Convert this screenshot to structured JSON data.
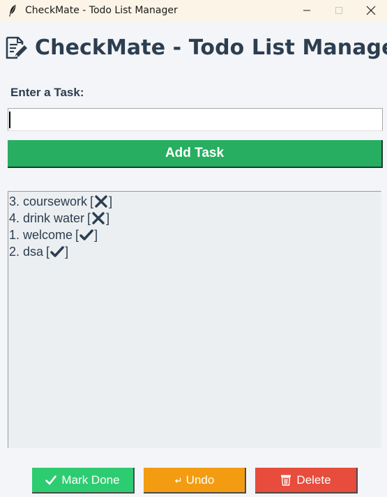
{
  "window": {
    "title": "CheckMate - Todo List Manager",
    "icon": "feather-icon"
  },
  "header": {
    "icon": "memo-pencil-icon",
    "title": "CheckMate - Todo List Manager"
  },
  "form": {
    "label": "Enter a Task:",
    "input_value": "",
    "add_button_label": "Add Task"
  },
  "tasks": [
    {
      "text": "3. coursework",
      "status": "pending",
      "status_icon": "cross-mark-icon"
    },
    {
      "text": "4. drink water",
      "status": "pending",
      "status_icon": "cross-mark-icon"
    },
    {
      "text": "1. welcome",
      "status": "done",
      "status_icon": "check-mark-icon"
    },
    {
      "text": "2. dsa",
      "status": "done",
      "status_icon": "check-mark-icon"
    }
  ],
  "actions": {
    "mark_done": {
      "icon": "check-mark-icon",
      "label": "Mark Done",
      "color": "#2ecc71"
    },
    "undo": {
      "icon": "undo-arrow-icon",
      "label": "Undo",
      "color": "#f39c12"
    },
    "delete": {
      "icon": "wastebasket-icon",
      "label": "Delete",
      "color": "#e74c3c"
    }
  },
  "colors": {
    "add_button": "#27ae60",
    "heading_text": "#2c3e50",
    "list_background": "#eceff1"
  }
}
